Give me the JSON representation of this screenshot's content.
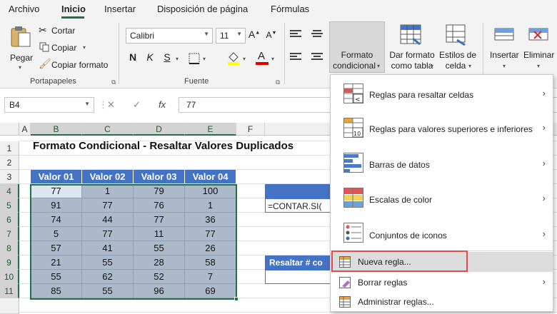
{
  "tabs": [
    "Archivo",
    "Inicio",
    "Insertar",
    "Disposición de página",
    "Fórmulas"
  ],
  "ribbon": {
    "paste": "Pegar",
    "cut": "Cortar",
    "copy": "Copiar",
    "format_painter": "Copiar formato",
    "clipboard_group": "Portapapeles",
    "font_name": "Calibri",
    "font_size": "11",
    "bold": "N",
    "italic": "K",
    "underline": "S",
    "font_group": "Fuente",
    "cond_format_1": "Formato",
    "cond_format_2": "condicional",
    "format_table_1": "Dar formato",
    "format_table_2": "como tabla",
    "cell_styles_1": "Estilos de",
    "cell_styles_2": "celda",
    "insert": "Insertar",
    "delete": "Eliminar"
  },
  "formula_bar": {
    "name_box": "B4",
    "fx": "fx",
    "cancel": "✕",
    "enter": "✓",
    "formula": "77"
  },
  "columns": [
    "A",
    "B",
    "C",
    "D",
    "E",
    "F"
  ],
  "rows": [
    "1",
    "2",
    "3",
    "4",
    "5",
    "6",
    "7",
    "8",
    "9",
    "10",
    "11"
  ],
  "sheet": {
    "title": "Formato Condicional - Resaltar Valores Duplicados",
    "headers": [
      "Valor 01",
      "Valor 02",
      "Valor 03",
      "Valor 04"
    ],
    "data": [
      [
        "77",
        "1",
        "79",
        "100"
      ],
      [
        "91",
        "77",
        "76",
        "1"
      ],
      [
        "74",
        "44",
        "77",
        "36"
      ],
      [
        "5",
        "77",
        "11",
        "77"
      ],
      [
        "57",
        "41",
        "55",
        "26"
      ],
      [
        "21",
        "55",
        "28",
        "58"
      ],
      [
        "55",
        "62",
        "52",
        "7"
      ],
      [
        "85",
        "55",
        "96",
        "69"
      ]
    ],
    "side_formula": "=CONTAR.SI(",
    "side_label": "Resaltar # co"
  },
  "menu": {
    "items": [
      "Reglas para resaltar celdas",
      "Reglas para valores superiores e inferiores",
      "Barras de datos",
      "Escalas de color",
      "Conjuntos de iconos",
      "Nueva regla...",
      "Borrar reglas",
      "Administrar reglas..."
    ],
    "top10_badge": "10"
  },
  "colors": {
    "accent_green": "#217346",
    "header_blue": "#4472c4",
    "data_fill": "#acb9ca",
    "highlight_border": "#e04b4b"
  }
}
